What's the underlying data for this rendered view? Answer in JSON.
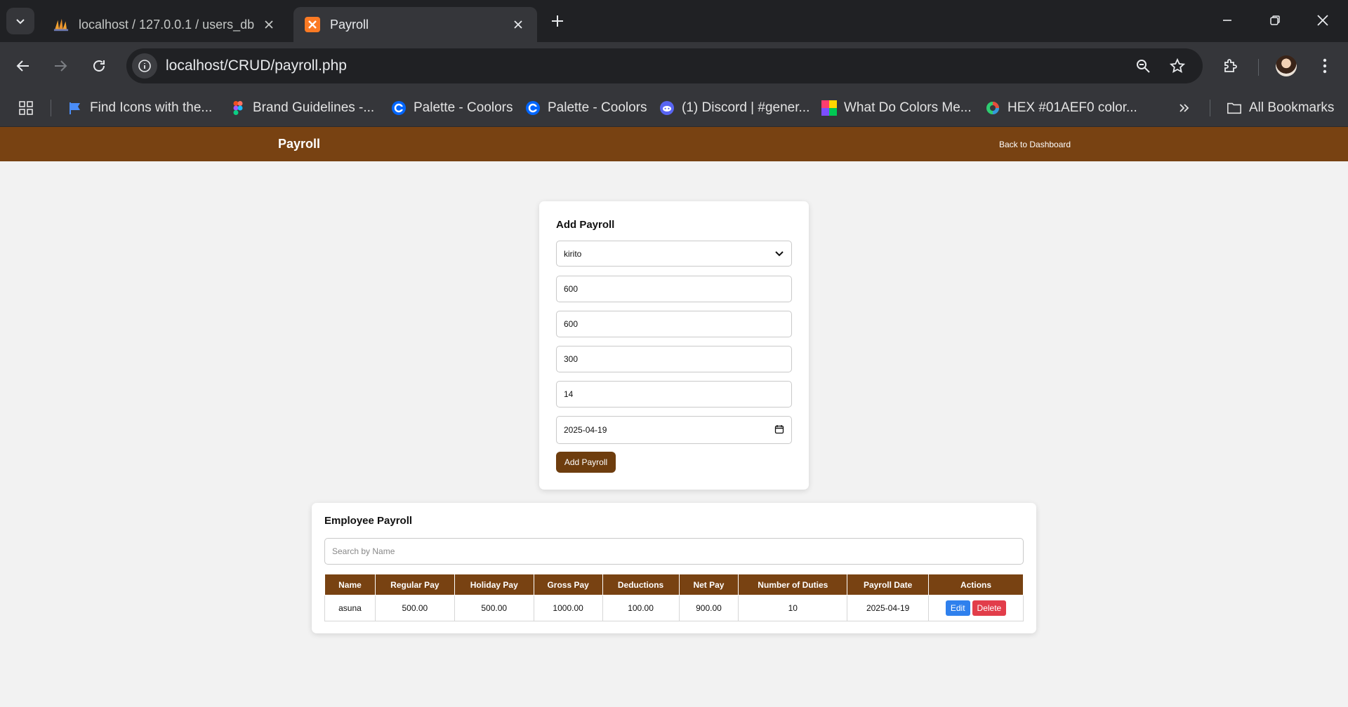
{
  "browser": {
    "tabs": [
      {
        "title": "localhost / 127.0.0.1 / users_db",
        "favicon": "phpmyadmin-icon"
      },
      {
        "title": "Payroll",
        "favicon": "xampp-icon"
      }
    ],
    "url": "localhost/CRUD/payroll.php",
    "bookmarks": [
      {
        "label": "Find Icons with the...",
        "icon": "flag-icon"
      },
      {
        "label": "Brand Guidelines -...",
        "icon": "figma-icon"
      },
      {
        "label": "Palette - Coolors",
        "icon": "coolors-icon"
      },
      {
        "label": "Palette - Coolors",
        "icon": "coolors-icon"
      },
      {
        "label": "(1) Discord | #gener...",
        "icon": "discord-icon"
      },
      {
        "label": "What Do Colors Me...",
        "icon": "color-grid-icon"
      },
      {
        "label": "HEX #01AEF0 color...",
        "icon": "color-wheel-icon"
      }
    ],
    "all_bookmarks": "All Bookmarks"
  },
  "nav": {
    "brand": "Payroll",
    "back_link": "Back to Dashboard",
    "color": "#784212"
  },
  "form": {
    "title": "Add Payroll",
    "employee": "kirito",
    "regular_pay": "600",
    "holiday_pay": "600",
    "deductions": "300",
    "duties": "14",
    "date": "2025-04-19",
    "submit": "Add Payroll"
  },
  "table_section": {
    "title": "Employee Payroll",
    "search_placeholder": "Search by Name",
    "headers": [
      "Name",
      "Regular Pay",
      "Holiday Pay",
      "Gross Pay",
      "Deductions",
      "Net Pay",
      "Number of Duties",
      "Payroll Date",
      "Actions"
    ],
    "rows": [
      {
        "name": "asuna",
        "regular_pay": "500.00",
        "holiday_pay": "500.00",
        "gross_pay": "1000.00",
        "deductions": "100.00",
        "net_pay": "900.00",
        "duties": "10",
        "date": "2025-04-19",
        "edit": "Edit",
        "delete": "Delete"
      }
    ]
  }
}
